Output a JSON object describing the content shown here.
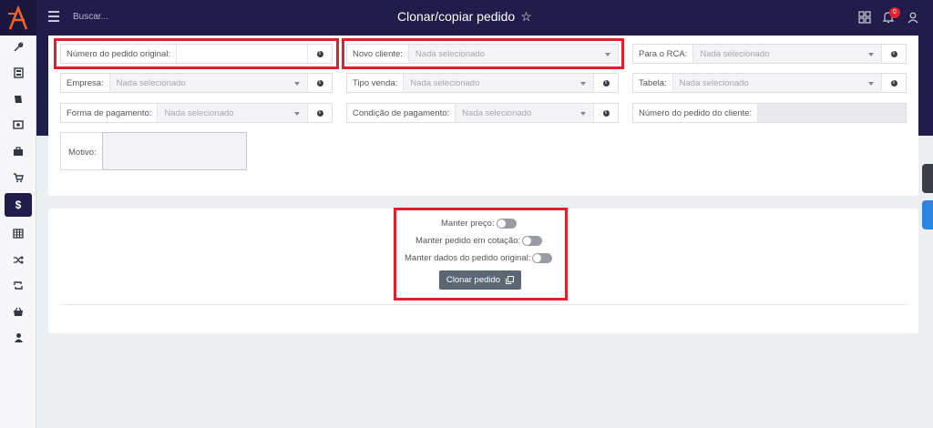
{
  "topbar": {
    "search_placeholder": "Buscar...",
    "title": "Clonar/copiar pedido",
    "notification_count": "0"
  },
  "sidebar": {
    "active_symbol": "$"
  },
  "form": {
    "placeholder": "Nada selecionado",
    "fields": {
      "numero_pedido_original": "Número do pedido original:",
      "novo_cliente": "Novo cliente:",
      "para_rca": "Para o RCA:",
      "empresa": "Empresa:",
      "tipo_venda": "Tipo venda:",
      "tabela": "Tabela:",
      "forma_pagamento": "Forma de pagamento:",
      "condicao_pagamento": "Condição de pagamento:",
      "numero_pedido_cliente": "Número do pedido do cliente:",
      "motivo": "Motivo:"
    }
  },
  "options": {
    "manter_preco": "Manter preço:",
    "manter_cotacao": "Manter pedido em cotação:",
    "manter_dados": "Manter dados do pedido original:",
    "clone_button": "Clonar pedido"
  },
  "colors": {
    "header": "#221c4a",
    "highlight": "#e0202a",
    "button": "#5c6774"
  }
}
